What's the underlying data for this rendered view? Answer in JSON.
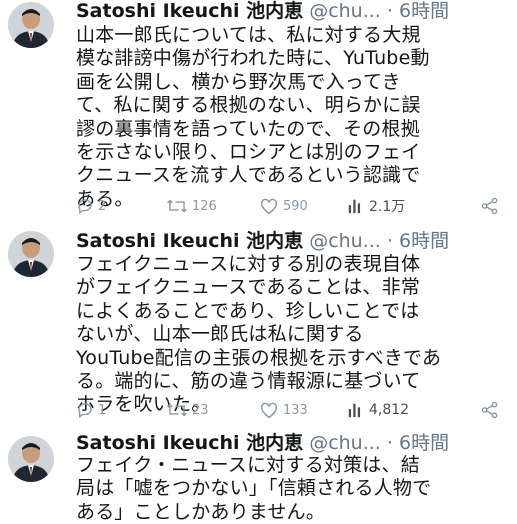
{
  "tweets": [
    {
      "author": "Satoshi Ikeuchi 池内恵",
      "handle": "@chu...",
      "time": "6時間",
      "text": "山本一郎氏については、私に対する大規\n模な誹謗中傷が行われた時に、YuTube動\n画を公開し、横から野次馬で入ってき\nて、私に関する根拠のない、明らかに誤\n謬の裏事情を語っていたので、その根拠\nを示さない限り、ロシアとは別のフェイ\nクニュースを流す人であるという認識で\nある。",
      "replies": "2",
      "retweets": "126",
      "likes": "590",
      "views": "2.1万"
    },
    {
      "author": "Satoshi Ikeuchi 池内恵",
      "handle": "@chu...",
      "time": "6時間",
      "text": "フェイクニュースに対する別の表現自体\nがフェイクニュースであることは、非常\nによくあることであり、珍しいことでは\nないが、山本一郎氏は私に関する\nYouTube配信の主張の根拠を示すべきであ\nる。端的に、筋の違う情報源に基づいて\nホラを吹いた。",
      "replies": "1",
      "retweets": "23",
      "likes": "133",
      "views": "4,812"
    },
    {
      "author": "Satoshi Ikeuchi 池内恵",
      "handle": "@chu...",
      "time": "6時間",
      "text": "フェイク・ニュースに対する対策は、結\n局は「嘘をつかない」「信頼される人物で\nある」ことしかありません。"
    }
  ],
  "icons": {
    "reply": "speech-bubble",
    "retweet": "retweet-arrows",
    "like": "heart",
    "views": "bar-chart",
    "share": "share-nodes"
  },
  "colors": {
    "name": "#14171a",
    "meta": "#657786",
    "icon": "#8899a6"
  }
}
